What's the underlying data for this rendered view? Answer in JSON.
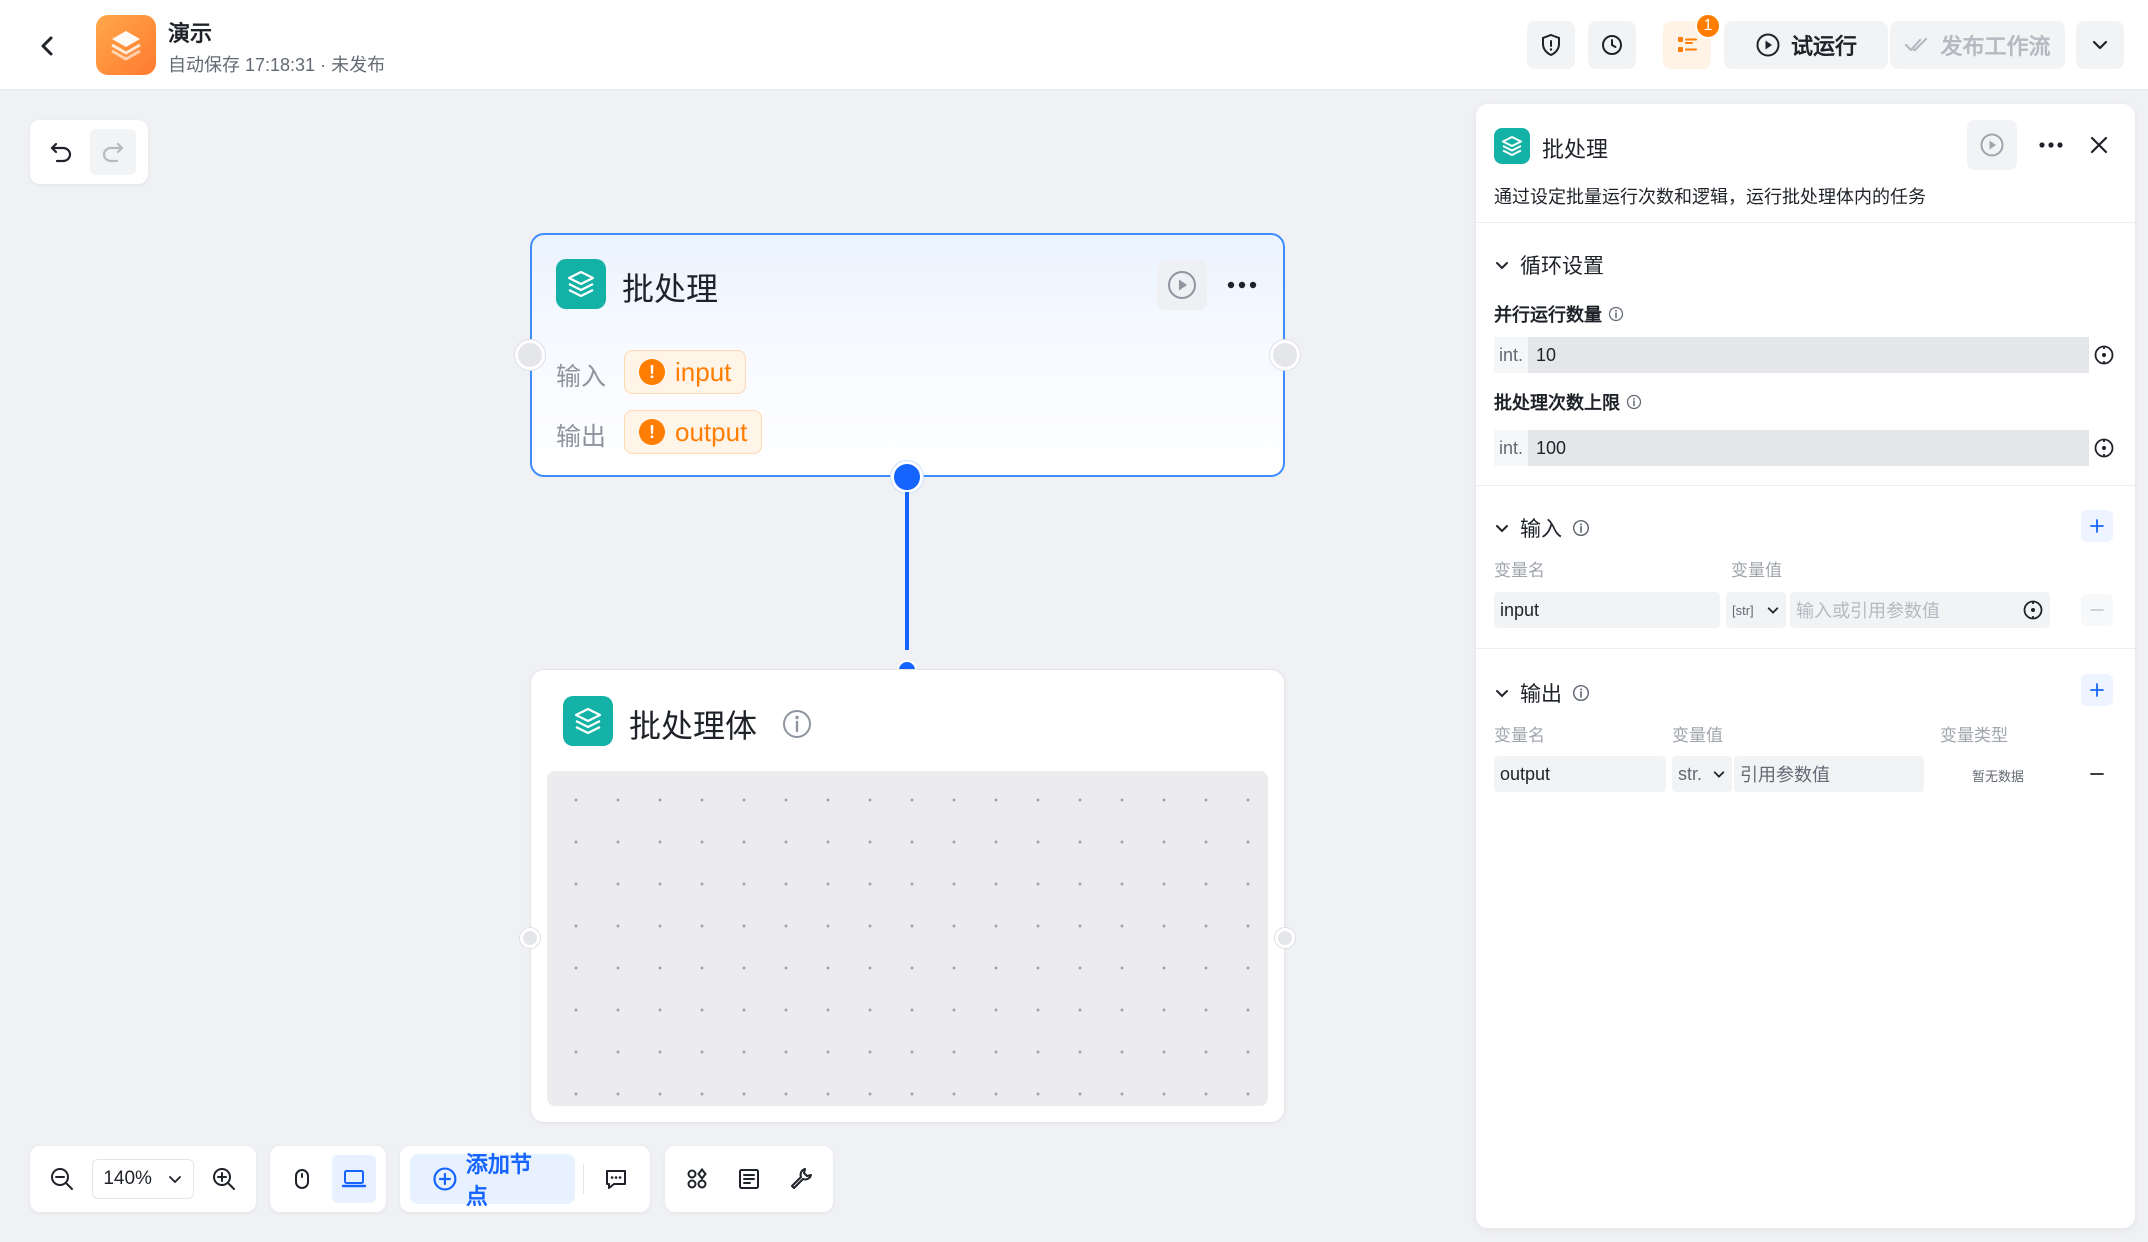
{
  "header": {
    "app_title": "演示",
    "save_status": "自动保存 17:18:31 · 未发布",
    "badge_count": "1",
    "trial_run_label": "试运行",
    "publish_label": "发布工作流",
    "logo_icon": "stack-layers-icon"
  },
  "canvas": {
    "batch_node": {
      "title": "批处理",
      "input_label": "输入",
      "input_chip": "input",
      "output_label": "输出",
      "output_chip": "output",
      "warn_glyph": "!"
    },
    "batch_body_node": {
      "title": "批处理体"
    }
  },
  "toolbar": {
    "zoom_value": "140%",
    "add_node_label": "添加节点"
  },
  "panel": {
    "title": "批处理",
    "description": "通过设定批量运行次数和逻辑，运行批处理体内的任务",
    "loop_section": {
      "title": "循环设置",
      "parallel_label": "并行运行数量",
      "parallel_type": "int.",
      "parallel_value": "10",
      "limit_label": "批处理次数上限",
      "limit_type": "int.",
      "limit_value": "100"
    },
    "input_section": {
      "title": "输入",
      "col_name": "变量名",
      "col_value": "变量值",
      "row_name": "input",
      "row_type": "[str]",
      "row_placeholder": "输入或引用参数值"
    },
    "output_section": {
      "title": "输出",
      "col_name": "变量名",
      "col_value": "变量值",
      "col_type": "变量类型",
      "row_name": "output",
      "row_type": "str.",
      "row_value_placeholder": "引用参数值",
      "row_type_value": "暂无数据"
    }
  },
  "colors": {
    "accent": "#1664ff",
    "node_icon": "#14b2a6",
    "warning": "#ff7d00",
    "logo": "#ff8c3a"
  }
}
